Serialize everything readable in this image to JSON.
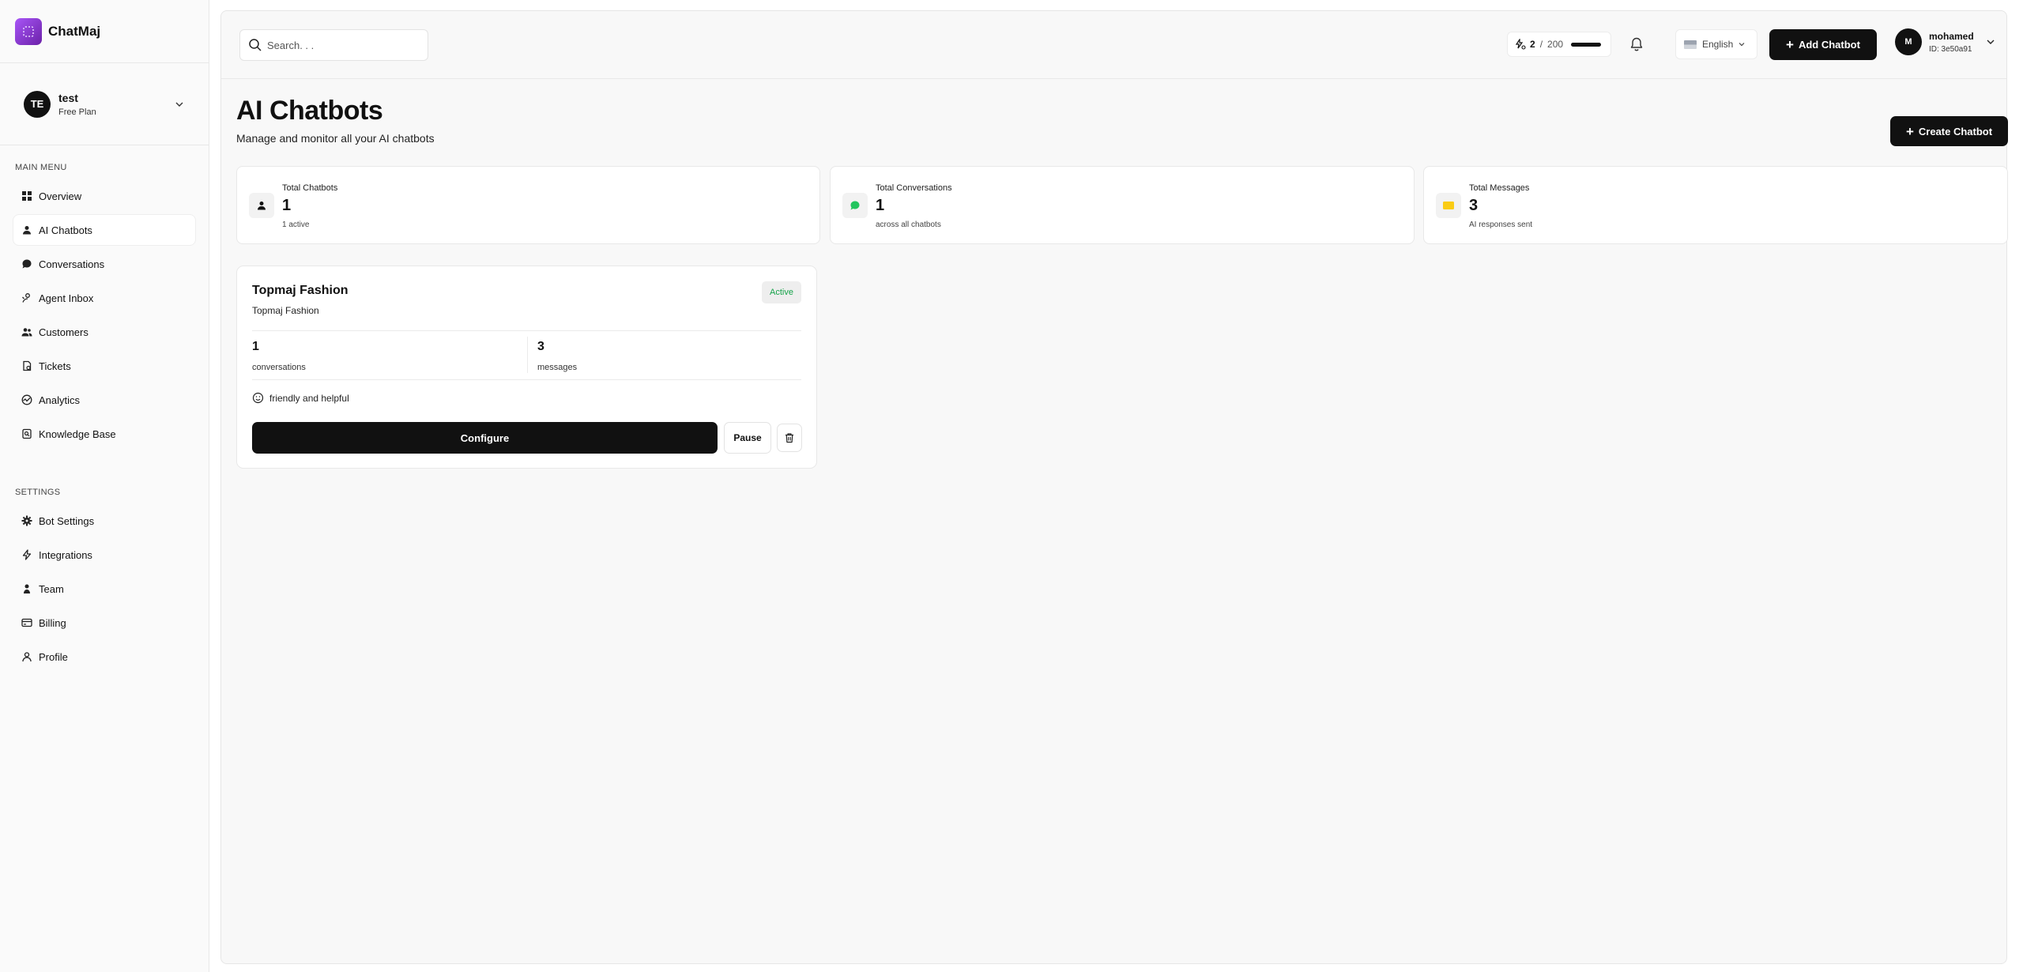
{
  "brand": {
    "name": "ChatMaj"
  },
  "org": {
    "initials": "TE",
    "name": "test",
    "plan": "Free Plan"
  },
  "sidebar": {
    "main_menu_label": "MAIN MENU",
    "main_items": [
      {
        "label": "Overview",
        "icon": "grid-icon"
      },
      {
        "label": "AI Chatbots",
        "icon": "bot-icon",
        "active": true
      },
      {
        "label": "Conversations",
        "icon": "chat-bubble-icon"
      },
      {
        "label": "Agent Inbox",
        "icon": "agent-icon"
      },
      {
        "label": "Customers",
        "icon": "users-icon"
      },
      {
        "label": "Tickets",
        "icon": "ticket-icon"
      },
      {
        "label": "Analytics",
        "icon": "analytics-icon"
      },
      {
        "label": "Knowledge Base",
        "icon": "book-icon"
      }
    ],
    "settings_label": "SETTINGS",
    "settings_items": [
      {
        "label": "Bot Settings",
        "icon": "gear-icon"
      },
      {
        "label": "Integrations",
        "icon": "lightning-icon"
      },
      {
        "label": "Team",
        "icon": "team-icon"
      },
      {
        "label": "Billing",
        "icon": "billing-icon"
      },
      {
        "label": "Profile",
        "icon": "profile-icon"
      }
    ]
  },
  "topbar": {
    "search_placeholder": "Search. . .",
    "credits": {
      "used": "2",
      "separator": "/",
      "total": "200"
    },
    "language": "English",
    "add_chatbot_label": "Add Chatbot",
    "user": {
      "initial": "M",
      "name": "mohamed",
      "id": "ID: 3e50a91"
    }
  },
  "page": {
    "title": "AI Chatbots",
    "subtitle": "Manage and monitor all your AI chatbots",
    "create_label": "Create Chatbot"
  },
  "stats": [
    {
      "label": "Total Chatbots",
      "value": "1",
      "sub": "1 active",
      "icon": "bot-icon",
      "color": "#111111"
    },
    {
      "label": "Total Conversations",
      "value": "1",
      "sub": "across all chatbots",
      "icon": "chat-bubble-icon",
      "color": "#22c55e"
    },
    {
      "label": "Total Messages",
      "value": "3",
      "sub": "AI responses sent",
      "icon": "message-icon",
      "color": "#facc15"
    }
  ],
  "chatbot": {
    "name": "Topmaj Fashion",
    "description": "Topmaj Fashion",
    "status": "Active",
    "conversations_value": "1",
    "conversations_label": "conversations",
    "messages_value": "3",
    "messages_label": "messages",
    "tone": "friendly and helpful",
    "configure_label": "Configure",
    "pause_label": "Pause"
  },
  "colors": {
    "accent": "#111111",
    "active_status": "#16a34a",
    "brand": "#9333ea"
  }
}
